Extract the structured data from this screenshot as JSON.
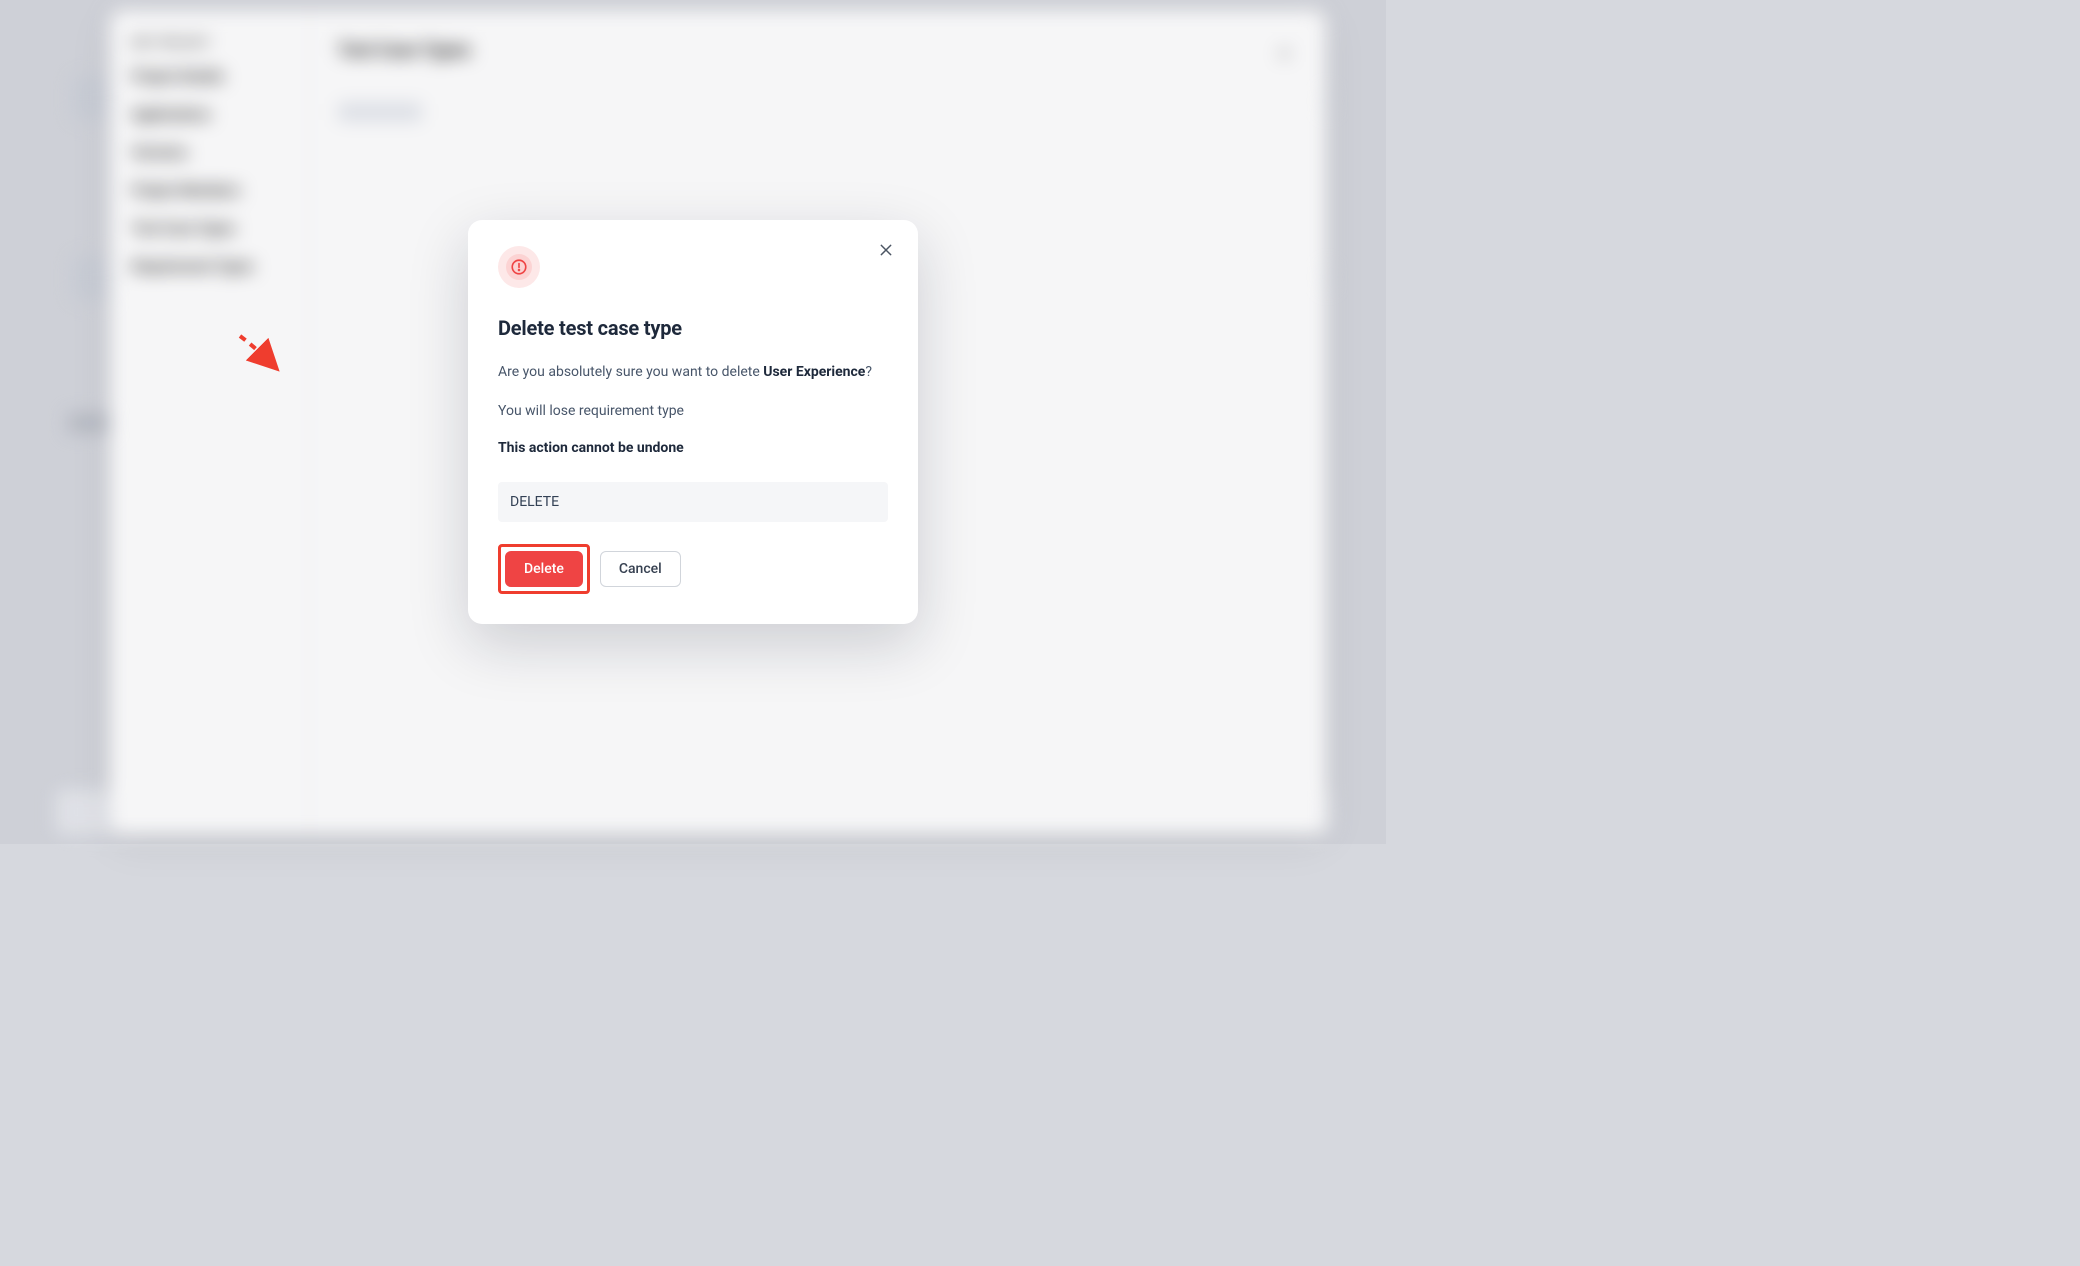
{
  "sidebar": {
    "section_label": "EDIT PROJECT",
    "items": [
      "Project Details",
      "Applications",
      "Versions",
      "Project Members",
      "Test Case Types",
      "Requirement Types"
    ]
  },
  "page": {
    "title": "Test Case Types"
  },
  "modal": {
    "title": "Delete test case type",
    "confirm_prefix": "Are you absolutely sure you want to delete ",
    "target_name": "User Experience",
    "confirm_suffix": "?",
    "effect_text": "You will lose requirement type",
    "warning": "This action cannot be undone",
    "input_value": "DELETE",
    "delete_label": "Delete",
    "cancel_label": "Cancel",
    "icon_name": "alert-circle-icon"
  }
}
